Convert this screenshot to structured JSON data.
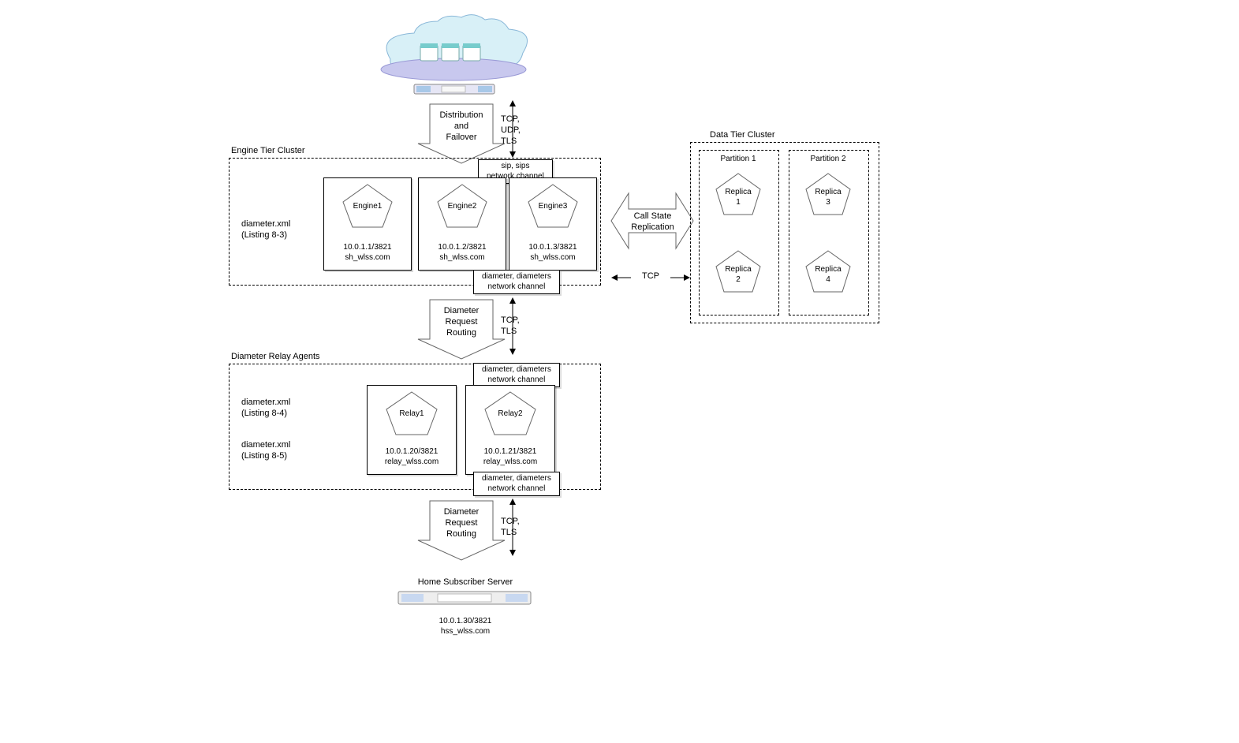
{
  "cloud": {
    "caption": ""
  },
  "arrows": {
    "distribution": "Distribution\nand\nFailover",
    "proto1": "TCP,\nUDP,\nTLS",
    "diameterRouting": "Diameter\nRequest\nRouting",
    "proto2": "TCP,\nTLS",
    "callstate": "Call State\nReplication",
    "tcp": "TCP"
  },
  "engineTier": {
    "title": "Engine Tier Cluster",
    "config": "diameter.xml\n(Listing 8-3)",
    "sipChannel": "sip, sips\nnetwork channel",
    "diamChannel": "diameter, diameters\nnetwork channel",
    "engines": [
      {
        "name": "Engine1",
        "addr": "10.0.1.1/3821\nsh_wlss.com"
      },
      {
        "name": "Engine2",
        "addr": "10.0.1.2/3821\nsh_wlss.com"
      },
      {
        "name": "Engine3",
        "addr": "10.0.1.3/3821\nsh_wlss.com"
      }
    ]
  },
  "relayTier": {
    "title": "Diameter Relay Agents",
    "config1": "diameter.xml\n(Listing 8-4)",
    "config2": "diameter.xml\n(Listing 8-5)",
    "topChannel": "diameter, diameters\nnetwork channel",
    "botChannel": "diameter, diameters\nnetwork channel",
    "relays": [
      {
        "name": "Relay1",
        "addr": "10.0.1.20/3821\nrelay_wlss.com"
      },
      {
        "name": "Relay2",
        "addr": "10.0.1.21/3821\nrelay_wlss.com"
      }
    ]
  },
  "hss": {
    "title": "Home Subscriber Server",
    "addr": "10.0.1.30/3821\nhss_wlss.com"
  },
  "dataTier": {
    "title": "Data Tier Cluster",
    "partitions": [
      {
        "title": "Partition 1",
        "replicas": [
          "Replica\n1",
          "Replica\n2"
        ]
      },
      {
        "title": "Partition 2",
        "replicas": [
          "Replica\n3",
          "Replica\n4"
        ]
      }
    ]
  }
}
